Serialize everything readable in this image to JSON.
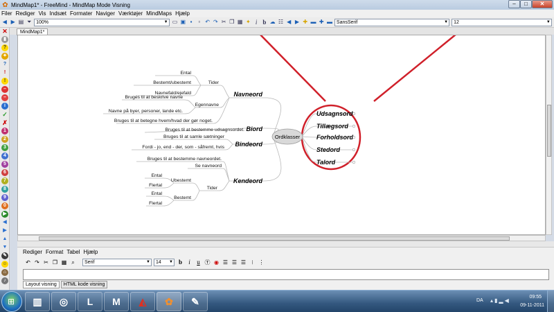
{
  "window": {
    "title": "MindMap1* - FreeMind - MindMap Mode Visning",
    "min": "–",
    "max": "□",
    "close": "✕"
  },
  "menu": [
    "Filer",
    "Rediger",
    "Vis",
    "Indsæt",
    "Formater",
    "Naviger",
    "Værktøjer",
    "MindMaps",
    "Hjælp"
  ],
  "toolbar": {
    "zoom": "100%",
    "font_family": "SansSerif",
    "font_size": "12"
  },
  "tab": "MindMap1*",
  "mindmap": {
    "root": "Ordklasser",
    "left_branches": [
      "Navneord",
      "Biord",
      "Bindeord",
      "Kendeord"
    ],
    "right_branches": [
      "Udsagnsord",
      "Tillægsord",
      "Forholdsord",
      "Stedord",
      "Talord"
    ],
    "navneord": {
      "tider": "Tider",
      "ental": "Ental",
      "bestemt_ubestemt": "Bestemt/ubestemt",
      "navnefald": "Navnefald/ejefald",
      "egennavne": "Egennavne",
      "beskrive": "Bruges til at beskrive navne",
      "navne_paa": "Navne på byer, personer, lande etc.",
      "betegne": "Bruges til at betegne hvem/hvad der gør noget."
    },
    "biord_note": "Bruges til at bestemme udsagnsordet.",
    "bindeord": {
      "note": "Bruges til at samle sætninger",
      "examples": "Fordi - jo, end - der, som - såfremt, hvis"
    },
    "kendeord": {
      "note": "Bruges til at bestemme navneordet.",
      "se_navneord": "Se navneord",
      "tider": "Tider",
      "ubestemt": "Ubestemt",
      "bestemt": "Bestemt",
      "ental": "Ental",
      "flertal": "Flertal"
    }
  },
  "editor": {
    "menu": [
      "Rediger",
      "Format",
      "Tabel",
      "Hjælp"
    ],
    "font_family": "Serif",
    "font_size": "14",
    "tabs": [
      "Layout visning",
      "HTML kode visning"
    ]
  },
  "taskbar": {
    "lang": "DA",
    "time": "09:55",
    "date": "09-11-2011",
    "start_glyph": "⊞"
  },
  "colors": {
    "annotation": "#d0202a",
    "edge": "#b8b8b8",
    "root_fill": "#d9d9d9"
  }
}
